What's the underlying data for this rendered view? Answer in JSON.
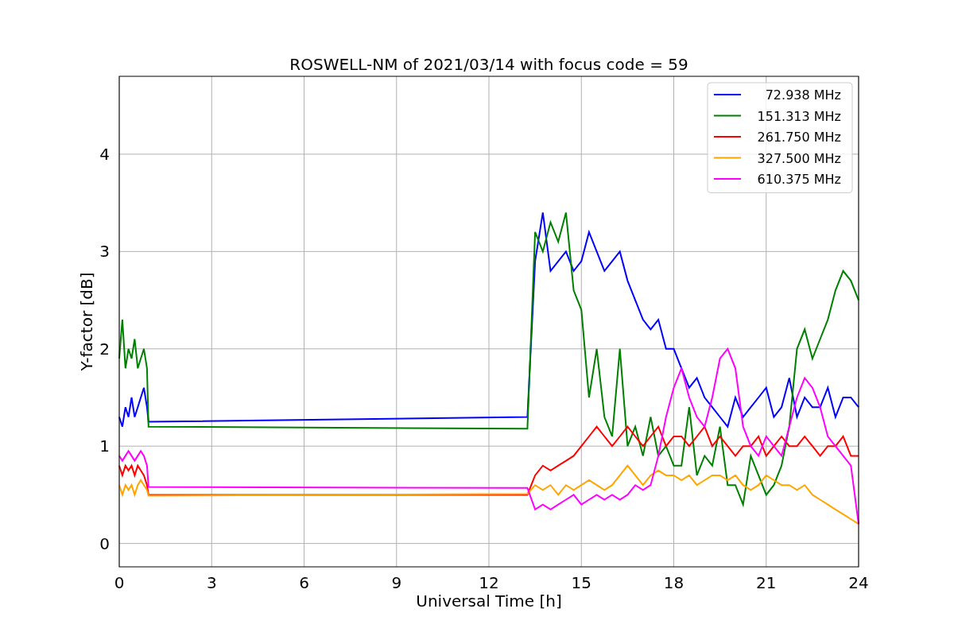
{
  "figure": {
    "chart_data": {
      "type": "line",
      "title": "ROSWELL-NM of 2021/03/14 with focus code = 59",
      "xlabel": "Universal Time [h]",
      "ylabel": "Y-factor [dB]",
      "x": [
        0,
        0.1,
        0.2,
        0.3,
        0.4,
        0.5,
        0.6,
        0.7,
        0.8,
        0.9,
        0.95,
        13.25,
        13.5,
        13.75,
        14,
        14.25,
        14.5,
        14.75,
        15,
        15.25,
        15.5,
        15.75,
        16,
        16.25,
        16.5,
        16.75,
        17,
        17.25,
        17.5,
        17.75,
        18,
        18.25,
        18.5,
        18.75,
        19,
        19.25,
        19.5,
        19.75,
        20,
        20.25,
        20.5,
        20.75,
        21,
        21.25,
        21.5,
        21.75,
        22,
        22.25,
        22.5,
        22.75,
        23,
        23.25,
        23.5,
        23.75,
        24
      ],
      "series": [
        {
          "name": "72.938 MHz",
          "color": "#0000ff",
          "values": [
            1.3,
            1.2,
            1.4,
            1.3,
            1.5,
            1.3,
            1.4,
            1.5,
            1.6,
            1.4,
            1.25,
            1.3,
            2.9,
            3.4,
            2.8,
            2.9,
            3.0,
            2.8,
            2.9,
            3.2,
            3.0,
            2.8,
            2.9,
            3.0,
            2.7,
            2.5,
            2.3,
            2.2,
            2.3,
            2.0,
            2.0,
            1.8,
            1.6,
            1.7,
            1.5,
            1.4,
            1.3,
            1.2,
            1.5,
            1.3,
            1.4,
            1.5,
            1.6,
            1.3,
            1.4,
            1.7,
            1.3,
            1.5,
            1.4,
            1.4,
            1.6,
            1.3,
            1.5,
            1.5,
            1.4
          ]
        },
        {
          "name": "151.313 MHz",
          "color": "#008000",
          "values": [
            1.9,
            2.3,
            1.8,
            2.0,
            1.9,
            2.1,
            1.8,
            1.9,
            2.0,
            1.8,
            1.2,
            1.18,
            3.2,
            3.0,
            3.3,
            3.1,
            3.4,
            2.6,
            2.4,
            1.5,
            2.0,
            1.3,
            1.1,
            2.0,
            1.0,
            1.2,
            0.9,
            1.3,
            0.9,
            1.0,
            0.8,
            0.8,
            1.4,
            0.7,
            0.9,
            0.8,
            1.2,
            0.6,
            0.6,
            0.4,
            0.9,
            0.7,
            0.5,
            0.6,
            0.8,
            1.2,
            2.0,
            2.2,
            1.9,
            2.1,
            2.3,
            2.6,
            2.8,
            2.7,
            2.5
          ]
        },
        {
          "name": "261.750 MHz",
          "color": "#ff0000",
          "values": [
            0.8,
            0.7,
            0.8,
            0.75,
            0.8,
            0.7,
            0.8,
            0.75,
            0.7,
            0.6,
            0.5,
            0.5,
            0.7,
            0.8,
            0.75,
            0.8,
            0.85,
            0.9,
            1.0,
            1.1,
            1.2,
            1.1,
            1.0,
            1.1,
            1.2,
            1.1,
            1.0,
            1.1,
            1.2,
            1.0,
            1.1,
            1.1,
            1.0,
            1.1,
            1.2,
            1.0,
            1.1,
            1.0,
            0.9,
            1.0,
            1.0,
            1.1,
            0.9,
            1.0,
            1.1,
            1.0,
            1.0,
            1.1,
            1.0,
            0.9,
            1.0,
            1.0,
            1.1,
            0.9,
            0.9
          ]
        },
        {
          "name": "327.500 MHz",
          "color": "#ffa500",
          "values": [
            0.6,
            0.5,
            0.6,
            0.55,
            0.6,
            0.5,
            0.6,
            0.65,
            0.6,
            0.55,
            0.49,
            0.51,
            0.6,
            0.55,
            0.6,
            0.5,
            0.6,
            0.55,
            0.6,
            0.65,
            0.6,
            0.55,
            0.6,
            0.7,
            0.8,
            0.7,
            0.6,
            0.7,
            0.75,
            0.7,
            0.7,
            0.65,
            0.7,
            0.6,
            0.65,
            0.7,
            0.7,
            0.65,
            0.7,
            0.6,
            0.55,
            0.6,
            0.7,
            0.65,
            0.6,
            0.6,
            0.55,
            0.6,
            0.5,
            0.45,
            0.4,
            0.35,
            0.3,
            0.25,
            0.2
          ]
        },
        {
          "name": "610.375 MHz",
          "color": "#ff00ff",
          "values": [
            0.9,
            0.85,
            0.9,
            0.95,
            0.9,
            0.85,
            0.9,
            0.95,
            0.9,
            0.8,
            0.58,
            0.57,
            0.35,
            0.4,
            0.35,
            0.4,
            0.45,
            0.5,
            0.4,
            0.45,
            0.5,
            0.45,
            0.5,
            0.45,
            0.5,
            0.6,
            0.55,
            0.6,
            0.9,
            1.3,
            1.6,
            1.8,
            1.5,
            1.3,
            1.2,
            1.5,
            1.9,
            2.0,
            1.8,
            1.2,
            1.0,
            0.9,
            1.1,
            1.0,
            0.9,
            1.2,
            1.5,
            1.7,
            1.6,
            1.4,
            1.1,
            1.0,
            0.9,
            0.8,
            0.2
          ]
        }
      ],
      "grid": true,
      "legend": true,
      "xlim": [
        0,
        24
      ],
      "ylim": [
        -0.24,
        4.8
      ],
      "xticks": [
        0,
        3,
        6,
        9,
        12,
        15,
        18,
        21,
        24
      ],
      "yticks": [
        0,
        1,
        2,
        3,
        4
      ]
    }
  }
}
